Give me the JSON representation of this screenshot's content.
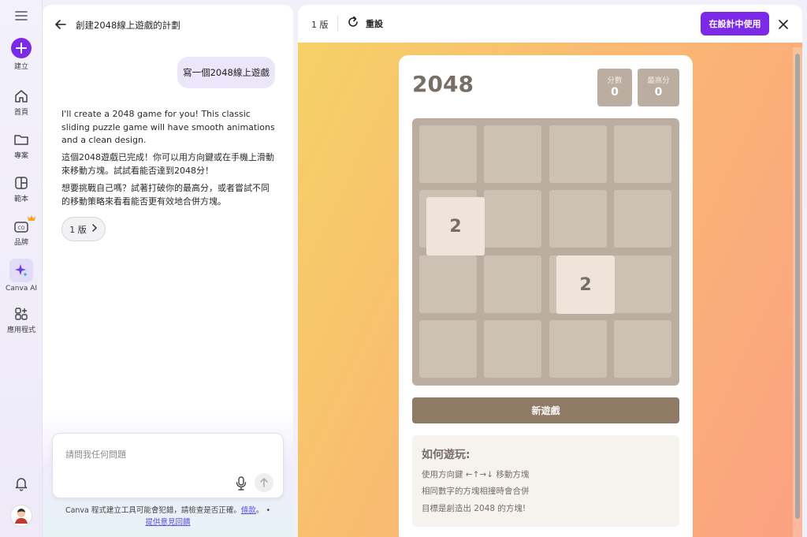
{
  "rail": {
    "create_label": "建立",
    "home_label": "首頁",
    "projects_label": "專案",
    "templates_label": "範本",
    "brand_label": "品牌",
    "canva_ai_label": "Canva AI",
    "apps_label": "應用程式"
  },
  "chat": {
    "title": "創建2048線上遊戲的計劃",
    "user_message": "寫一個2048線上遊戲",
    "ai_paragraphs": [
      "I'll create a 2048 game for you! This classic sliding puzzle game will have smooth animations and a clean design.",
      "這個2048遊戲已完成！你可以用方向鍵或在手機上滑動來移動方塊。試試看能否達到2048分！",
      "想要挑戰自己嗎？試著打破你的最高分，或者嘗試不同的移動策略來看看能否更有效地合併方塊。"
    ],
    "version_pill": "1 版",
    "input_placeholder": "請問我任何問題",
    "disclaimer_text": "Canva 程式建立工具可能會犯錯，請檢查是否正確。",
    "disclaimer_link": "條款",
    "disclaimer_end": "。",
    "feedback_link": "提供意見回饋"
  },
  "preview": {
    "version_label": "1 版",
    "reset_label": "重設",
    "use_button": "在設計中使用"
  },
  "game": {
    "title": "2048",
    "score_label": "分數",
    "score_value": "0",
    "best_label": "最高分",
    "best_value": "0",
    "tiles": [
      {
        "row": 2,
        "col": 1,
        "value": "2"
      },
      {
        "row": 3,
        "col": 3,
        "value": "2"
      }
    ],
    "new_game_button": "新遊戲",
    "howto_title": "如何遊玩:",
    "howto_lines": [
      "使用方向鍵 ←↑→↓ 移動方塊",
      "相同數字的方塊相撞時會合併",
      "目標是創造出 2048 的方塊!"
    ]
  },
  "colors": {
    "accent": "#7d2ae8",
    "board": "#bbada0",
    "cell": "#cdc1b4",
    "tile_2": "#eee4da",
    "new_game": "#8f7a66"
  }
}
